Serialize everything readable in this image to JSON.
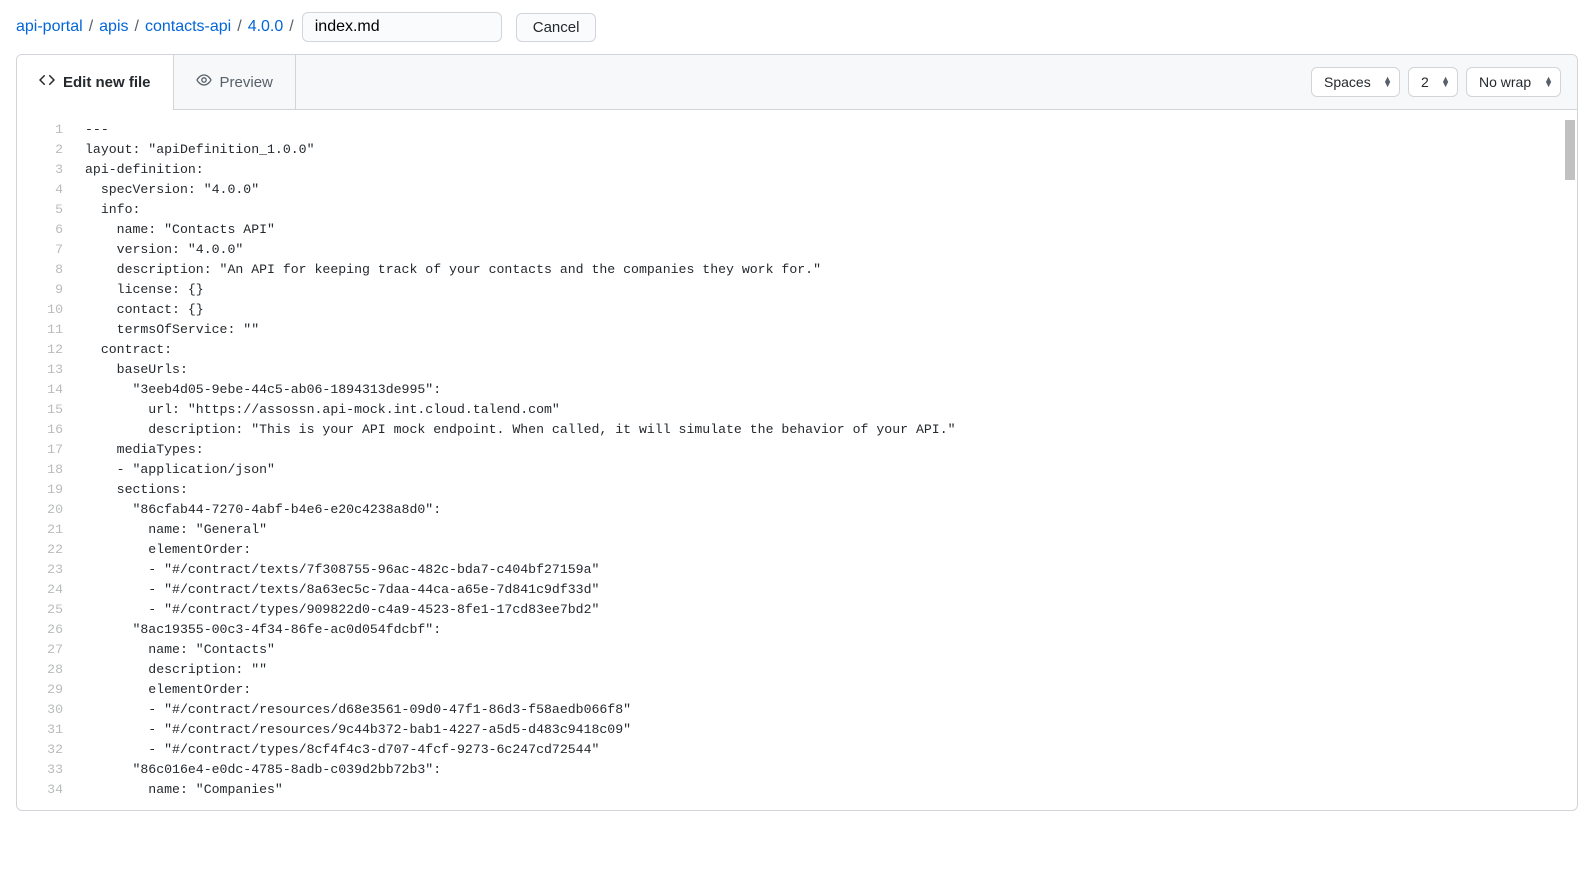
{
  "breadcrumb": {
    "parts": [
      "api-portal",
      "apis",
      "contacts-api",
      "4.0.0"
    ],
    "filename_value": "index.md"
  },
  "buttons": {
    "cancel": "Cancel"
  },
  "tabs": {
    "edit": "Edit new file",
    "preview": "Preview"
  },
  "selects": {
    "indent_mode": "Spaces",
    "indent_size": "2",
    "wrap_mode": "No wrap"
  },
  "editor": {
    "lines": [
      "---",
      "layout: \"apiDefinition_1.0.0\"",
      "api-definition:",
      "  specVersion: \"4.0.0\"",
      "  info:",
      "    name: \"Contacts API\"",
      "    version: \"4.0.0\"",
      "    description: \"An API for keeping track of your contacts and the companies they work for.\"",
      "    license: {}",
      "    contact: {}",
      "    termsOfService: \"\"",
      "  contract:",
      "    baseUrls:",
      "      \"3eeb4d05-9ebe-44c5-ab06-1894313de995\":",
      "        url: \"https://assossn.api-mock.int.cloud.talend.com\"",
      "        description: \"This is your API mock endpoint. When called, it will simulate the behavior of your API.\"",
      "    mediaTypes:",
      "    - \"application/json\"",
      "    sections:",
      "      \"86cfab44-7270-4abf-b4e6-e20c4238a8d0\":",
      "        name: \"General\"",
      "        elementOrder:",
      "        - \"#/contract/texts/7f308755-96ac-482c-bda7-c404bf27159a\"",
      "        - \"#/contract/texts/8a63ec5c-7daa-44ca-a65e-7d841c9df33d\"",
      "        - \"#/contract/types/909822d0-c4a9-4523-8fe1-17cd83ee7bd2\"",
      "      \"8ac19355-00c3-4f34-86fe-ac0d054fdcbf\":",
      "        name: \"Contacts\"",
      "        description: \"\"",
      "        elementOrder:",
      "        - \"#/contract/resources/d68e3561-09d0-47f1-86d3-f58aedb066f8\"",
      "        - \"#/contract/resources/9c44b372-bab1-4227-a5d5-d483c9418c09\"",
      "        - \"#/contract/types/8cf4f4c3-d707-4fcf-9273-6c247cd72544\"",
      "      \"86c016e4-e0dc-4785-8adb-c039d2bb72b3\":",
      "        name: \"Companies\""
    ]
  }
}
